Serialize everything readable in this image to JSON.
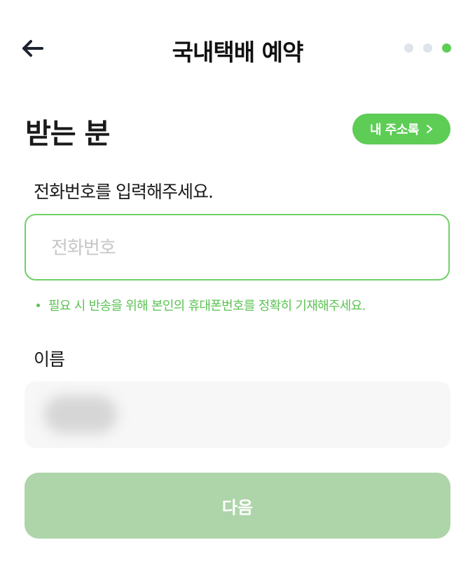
{
  "header": {
    "title": "국내택배 예약",
    "back_icon": "arrow-left-icon",
    "steps": [
      {
        "state": "inactive"
      },
      {
        "state": "inactive"
      },
      {
        "state": "active"
      }
    ]
  },
  "recipient": {
    "title": "받는 분",
    "address_book_label": "내 주소록",
    "address_book_icon": "chevron-right-icon"
  },
  "phone": {
    "label": "전화번호를 입력해주세요.",
    "placeholder": "전화번호",
    "value": "",
    "hint": "필요 시 반송을 위해 본인의 휴대폰번호를 정확히 기재해주세요."
  },
  "name": {
    "label": "이름",
    "value_obscured": true
  },
  "next_button": {
    "label": "다음"
  },
  "colors": {
    "accent": "#5dcd55",
    "next_disabled": "#aed5a9",
    "step_inactive": "#dfe3ea"
  }
}
